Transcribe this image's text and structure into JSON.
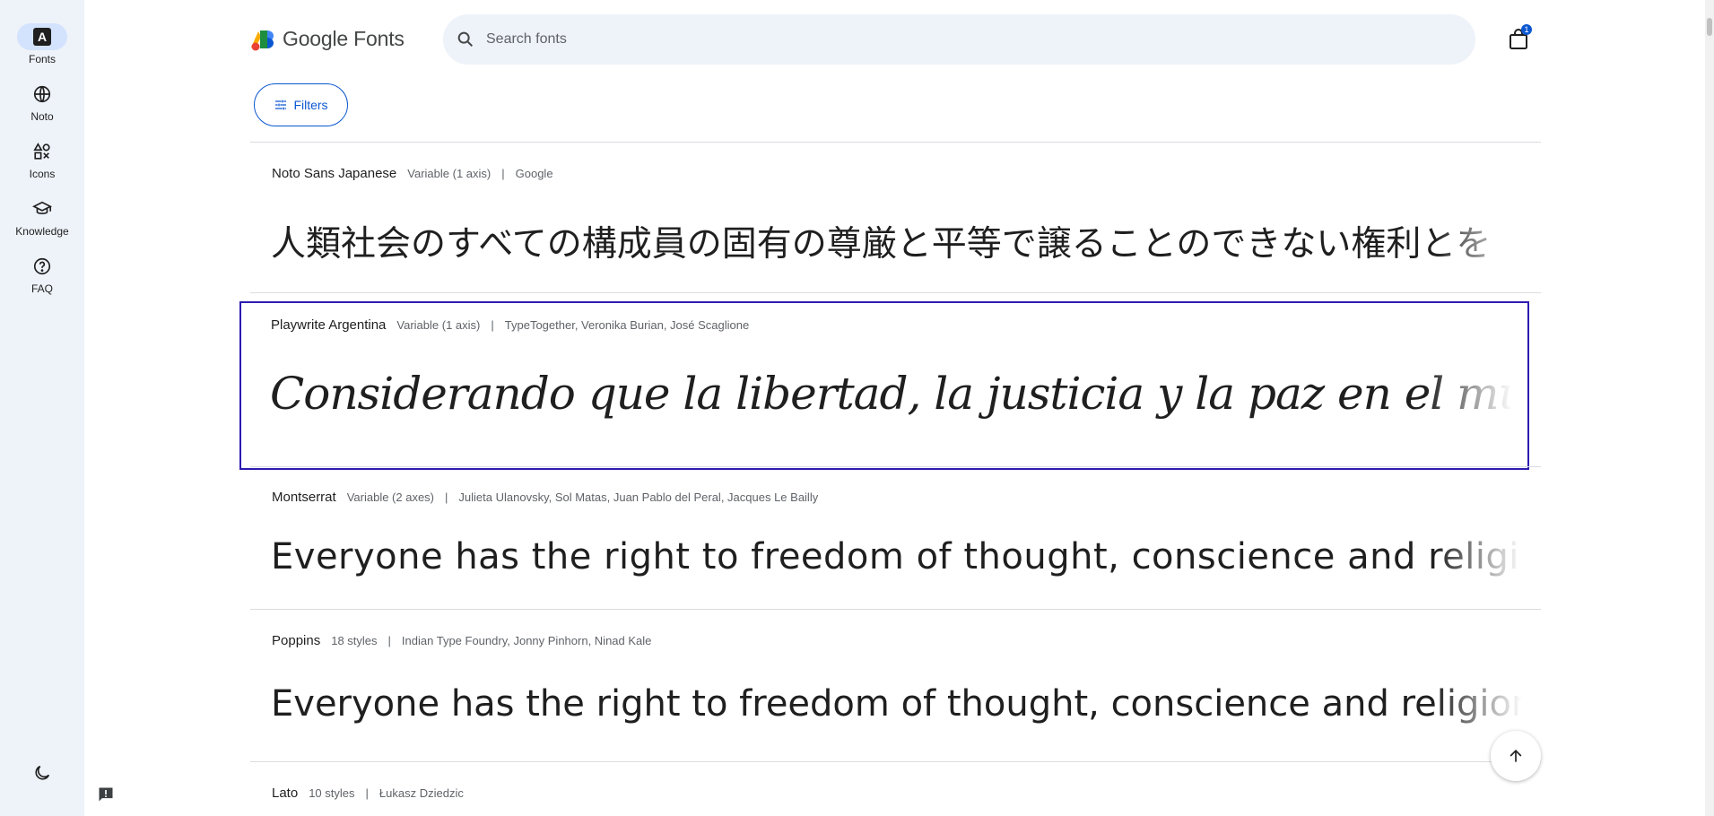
{
  "rail": {
    "items": [
      {
        "label": "Fonts",
        "icon": "fonts-icon",
        "active": true
      },
      {
        "label": "Noto",
        "icon": "globe-icon"
      },
      {
        "label": "Icons",
        "icon": "shapes-icon"
      },
      {
        "label": "Knowledge",
        "icon": "school-icon"
      },
      {
        "label": "FAQ",
        "icon": "help-icon"
      }
    ],
    "fonts_glyph": "A"
  },
  "header": {
    "logo_text": "Google Fonts",
    "search_placeholder": "Search fonts",
    "cart_count": "1"
  },
  "filters_label": "Filters",
  "fonts": [
    {
      "family": "Noto Sans Japanese",
      "styles": "Variable (1 axis)",
      "designers": "Google",
      "sample": "人類社会のすべての構成員の固有の尊厳と平等で譲ることのできない権利とを"
    },
    {
      "family": "Playwrite Argentina",
      "styles": "Variable (1 axis)",
      "designers": "TypeTogether, Veronika Burian, José Scaglione",
      "sample": "Considerando que la libertad, la justicia y la paz en el mundo tienen"
    },
    {
      "family": "Montserrat",
      "styles": "Variable (2 axes)",
      "designers": "Julieta Ulanovsky, Sol Matas, Juan Pablo del Peral, Jacques Le Bailly",
      "sample": "Everyone has the right to freedom of thought, conscience and religion"
    },
    {
      "family": "Poppins",
      "styles": "18 styles",
      "designers": "Indian Type Foundry, Jonny Pinhorn, Ninad Kale",
      "sample": "Everyone has the right to freedom of thought, conscience and religion"
    },
    {
      "family": "Lato",
      "styles": "10 styles",
      "designers": "Łukasz Dziedzic"
    }
  ],
  "separator": "|",
  "colors": {
    "accent": "#0b57d0",
    "selected_outline": "#2c1bb0",
    "rail_bg": "#eef2f9"
  }
}
